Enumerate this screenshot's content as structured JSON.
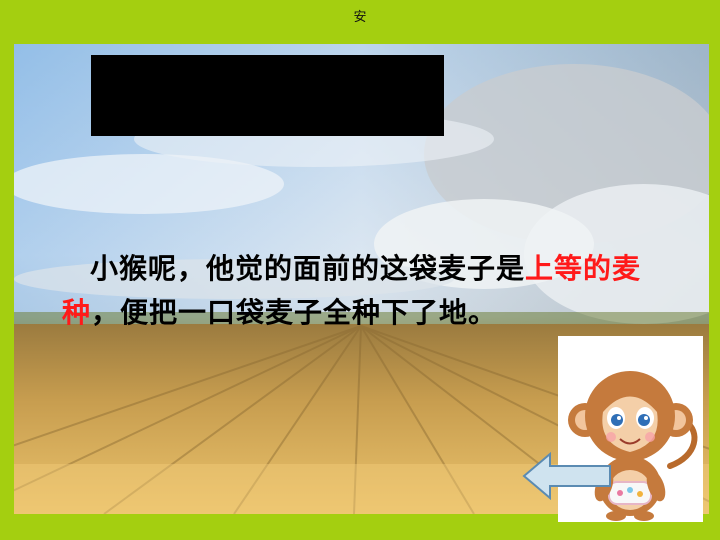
{
  "header": {
    "title": "安"
  },
  "story": {
    "intro": "小猴呢，他觉的面前的这袋麦子是",
    "highlight": "上等的麦种",
    "ending": "，便把一口袋麦子全种下了地。"
  },
  "colors": {
    "background": "#a4cf10",
    "highlight": "#ff1a1a",
    "arrow": "#cfe3ef"
  },
  "icons": {
    "monkey": "monkey-cartoon-icon",
    "back": "left-arrow-icon"
  }
}
